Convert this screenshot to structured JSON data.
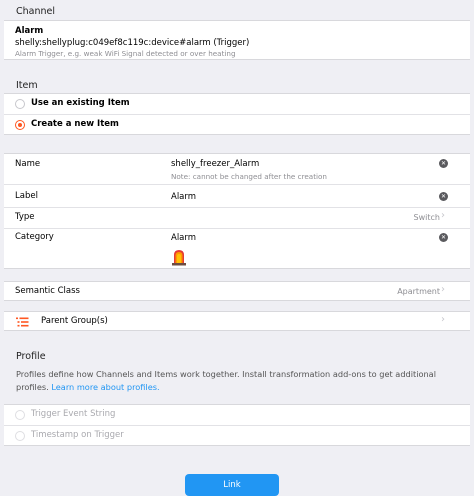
{
  "channel": {
    "section_label": "Channel",
    "name": "Alarm",
    "uid": "shelly:shellyplug:c049ef8c119c:device#alarm (Trigger)",
    "description": "Alarm Trigger, e.g. weak WiFi Signal detected or over heating"
  },
  "item": {
    "section_label": "Item",
    "use_existing_label": "Use an existing Item",
    "create_new_label": "Create a new Item"
  },
  "form": {
    "name_label": "Name",
    "name_value": "shelly_freezer_Alarm",
    "name_note": "Note: cannot be changed after the creation",
    "label_label": "Label",
    "label_value": "Alarm",
    "type_label": "Type",
    "type_value": "Switch",
    "category_label": "Category",
    "category_value": "Alarm"
  },
  "semantic": {
    "label": "Semantic Class",
    "value": "Apartment"
  },
  "parent": {
    "label": "Parent Group(s)"
  },
  "profile": {
    "section_label": "Profile",
    "description": "Profiles define how Channels and Items work together. Install transformation add-ons to get additional profiles.",
    "learn_more": "Learn more about profiles.",
    "options": [
      "Trigger Event String",
      "Timestamp on Trigger"
    ]
  },
  "footer": {
    "link_label": "Link"
  },
  "colors": {
    "accent": "#ff5722",
    "primary": "#2196f3",
    "background": "#efeff4"
  }
}
